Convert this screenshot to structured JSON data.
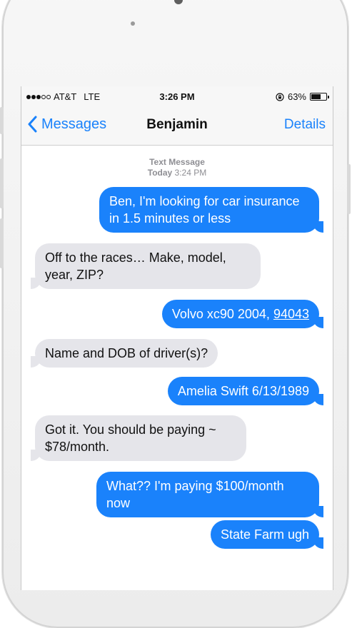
{
  "status": {
    "carrier": "AT&T",
    "network": "LTE",
    "time": "3:26 PM",
    "battery": "63%",
    "battery_level": 0.63
  },
  "nav": {
    "back_label": "Messages",
    "title": "Benjamin",
    "details_label": "Details"
  },
  "meta": {
    "service": "Text Message",
    "day": "Today",
    "time": "3:24 PM"
  },
  "messages": [
    {
      "text": "Ben, I'm looking for car insurance in 1.5 minutes or less"
    },
    {
      "text": "Off to the races… Make, model, year, ZIP?"
    },
    {
      "text_prefix": "Volvo xc90 2004, ",
      "zip": "94043"
    },
    {
      "text": "Name and DOB of driver(s)?"
    },
    {
      "text": "Amelia Swift 6/13/1989"
    },
    {
      "text": "Got it. You should be paying ~ $78/month."
    },
    {
      "text": "What?? I'm paying $100/month now"
    },
    {
      "text": "State Farm ugh"
    }
  ],
  "colors": {
    "accent": "#1a82fb",
    "incoming_bubble": "#e5e5ea",
    "outgoing_bubble": "#1a82fb"
  }
}
